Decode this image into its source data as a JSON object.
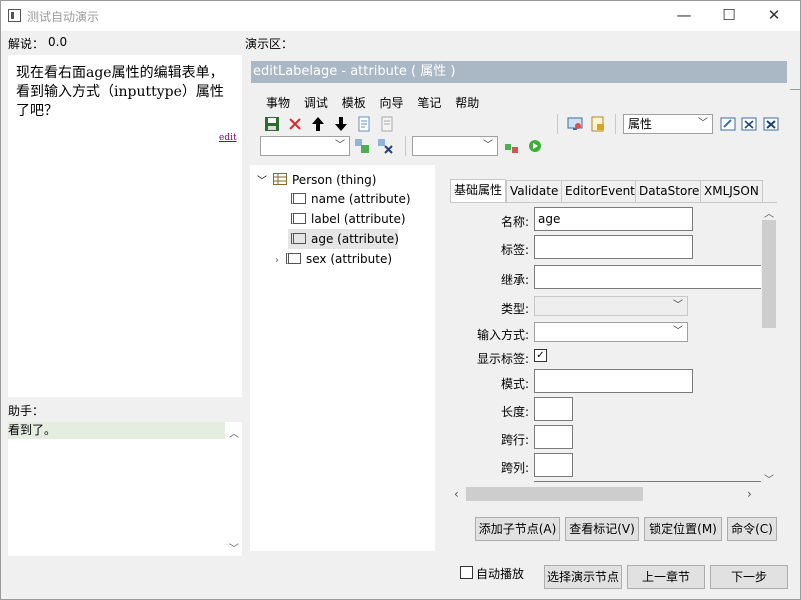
{
  "window": {
    "title": "测试自动演示",
    "minimize": "—",
    "maximize": "☐",
    "close": "✕"
  },
  "left": {
    "explain_label": "解说：",
    "explain_value": "0.0",
    "explain_text": "现在看右面age属性的编辑表单，看到输入方式（inputtype）属性了吧？",
    "edit_link": "edit",
    "assistant_label": "助手：",
    "assistant_line": "看到了。"
  },
  "demo": {
    "label": "演示区：",
    "header": "editLabelage - attribute ( 属性 )",
    "menu": [
      "事物",
      "调试",
      "模板",
      "向导",
      "笔记",
      "帮助"
    ],
    "attr_combo": "属性"
  },
  "tree": {
    "root": "Person (thing)",
    "items": [
      "name (attribute)",
      "label (attribute)",
      "age (attribute)",
      "sex (attribute)"
    ]
  },
  "tabs": [
    "基础属性",
    "Validate",
    "EditorEvent",
    "DataStore",
    "XMLJSON"
  ],
  "form": {
    "name_label": "名称:",
    "name_value": "age",
    "tag_label": "标签:",
    "inherit_label": "继承:",
    "type_label": "类型:",
    "input_label": "输入方式:",
    "show_label": "显示标签:",
    "show_checked": "✓",
    "pattern_label": "模式:",
    "length_label": "长度:",
    "rowspan_label": "跨行:",
    "colspan_label": "跨列:"
  },
  "buttons": {
    "add_child": "添加子节点(A)",
    "view_marks": "查看标记(V)",
    "lock_pos": "锁定位置(M)",
    "command": "命令(C)",
    "autoplay": "自动播放",
    "select_node": "选择演示节点",
    "prev_chapter": "上一章节",
    "next_step": "下一步"
  },
  "colors": {
    "header_bg": "#aab7c4",
    "assistant_bg": "#e4ede0",
    "selected_bg": "#e5e5e5",
    "save_icon": "#2f6b2f",
    "delete_icon": "#d92b2b"
  }
}
